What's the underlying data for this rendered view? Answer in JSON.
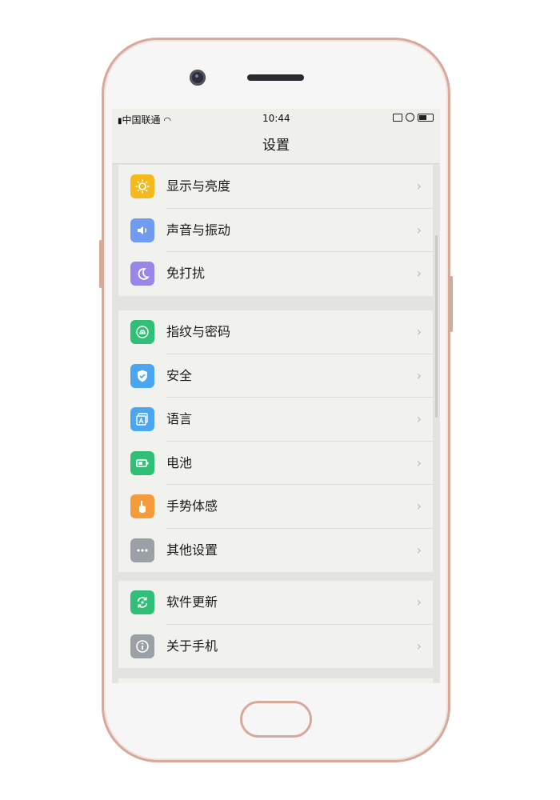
{
  "status_bar": {
    "carrier": "中国联通",
    "time": "10:44"
  },
  "title": "设置",
  "groups": [
    {
      "items": [
        {
          "label": "显示与亮度",
          "icon": "brightness-icon",
          "color": "#f6b91c"
        },
        {
          "label": "声音与振动",
          "icon": "speaker-icon",
          "color": "#6f9cf0"
        },
        {
          "label": "免打扰",
          "icon": "moon-icon",
          "color": "#9a86e8"
        }
      ]
    },
    {
      "items": [
        {
          "label": "指纹与密码",
          "icon": "fingerprint-icon",
          "color": "#2fbf76"
        },
        {
          "label": "安全",
          "icon": "shield-icon",
          "color": "#4aa6f0"
        },
        {
          "label": "语言",
          "icon": "language-icon",
          "color": "#4aa6f0"
        },
        {
          "label": "电池",
          "icon": "battery-icon",
          "color": "#2fbf76"
        },
        {
          "label": "手势体感",
          "icon": "hand-icon",
          "color": "#f59b3a"
        },
        {
          "label": "其他设置",
          "icon": "more-icon",
          "color": "#9aa0a6"
        }
      ]
    },
    {
      "items": [
        {
          "label": "软件更新",
          "icon": "update-icon",
          "color": "#2fbf76"
        },
        {
          "label": "关于手机",
          "icon": "info-icon",
          "color": "#9aa0a6"
        }
      ]
    }
  ]
}
